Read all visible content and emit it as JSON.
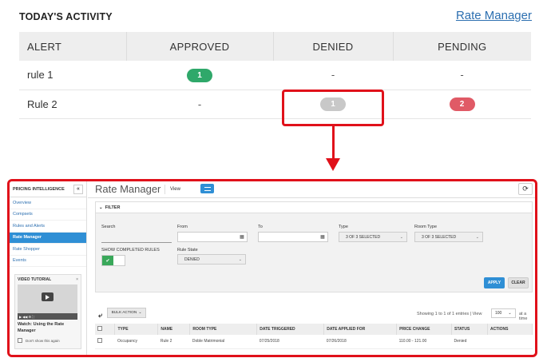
{
  "activity": {
    "title": "TODAY'S ACTIVITY",
    "rate_manager_link": "Rate Manager",
    "columns": [
      "ALERT",
      "APPROVED",
      "DENIED",
      "PENDING"
    ],
    "rows": [
      {
        "alert": "rule 1",
        "approved": "1",
        "denied": "-",
        "pending": "-"
      },
      {
        "alert": "Rule 2",
        "approved": "-",
        "denied": "1",
        "pending": "2"
      }
    ],
    "colors": {
      "approved": "#2fa86a",
      "denied": "#c8c8c8",
      "pending": "#e05a66",
      "highlight": "#e0111a"
    }
  },
  "rate_manager": {
    "sidebar": {
      "header": "PRICING INTELLIGENCE",
      "collapse": "«",
      "items": [
        "Overview",
        "Compsets",
        "Rules and Alerts",
        "Rate Manager",
        "Rate Shopper",
        "Events"
      ],
      "active_item": "Rate Manager",
      "video": {
        "title": "VIDEO TUTORIAL",
        "close": "×",
        "caption": "Watch: Using the Rate Manager",
        "dont_show": "Don't show this again"
      }
    },
    "title": "Rate Manager",
    "view_label": "View",
    "refresh": "⟳",
    "filter": {
      "header": "FILTER",
      "search_label": "Search",
      "from_label": "From",
      "to_label": "To",
      "type_label": "Type",
      "type_value": "3 OF 3 SELECTED",
      "room_type_label": "Room Type",
      "room_type_value": "3 OF 3 SELECTED",
      "show_completed_label": "SHOW COMPLETED RULES",
      "rule_state_label": "Rule State",
      "rule_state_value": "DENIED",
      "apply": "APPLY",
      "clear": "CLEAR"
    },
    "bulk_action": "BULK ACTION",
    "showing": "Showing 1 to 1 of 1 entries",
    "view_sep": "| View",
    "per_page": "100",
    "at_a_time": "at a time",
    "table": {
      "columns": [
        "TYPE",
        "NAME",
        "ROOM TYPE",
        "DATE TRIGGERED",
        "DATE APPLIED FOR",
        "PRICE CHANGE",
        "STATUS",
        "ACTIONS"
      ],
      "rows": [
        {
          "type": "Occupancy",
          "name": "Rule 2",
          "room_type": "Doble Matrimonial",
          "date_triggered": "07/25/2018",
          "date_applied": "07/26/2018",
          "price_change": "110.00 - 121.00",
          "status": "Denied",
          "actions": ""
        }
      ]
    }
  }
}
